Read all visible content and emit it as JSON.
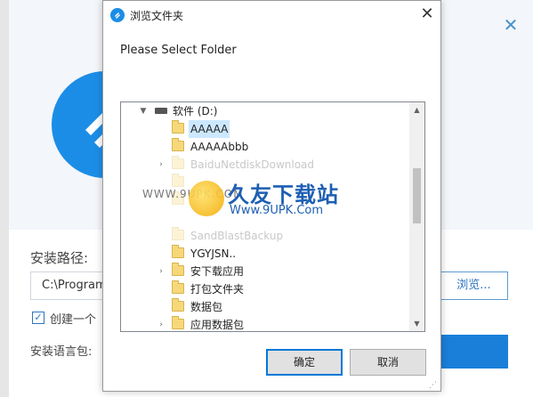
{
  "installer": {
    "path_label": "安装路径:",
    "path_value": "C:\\Program",
    "browse_label": "浏览...",
    "create_shortcut_label": "创建一个",
    "lang_label": "安装语言包:",
    "close_glyph": "✕"
  },
  "dialog": {
    "title": "浏览文件夹",
    "prompt": "Please Select Folder",
    "close_glyph": "✕",
    "ok_label": "确定",
    "cancel_label": "取消",
    "tree": [
      {
        "label": "软件 (D:)",
        "type": "drive",
        "expanded": true
      },
      {
        "label": "AAAAA",
        "type": "folder",
        "selected": true
      },
      {
        "label": "AAAAAbbb",
        "type": "folder"
      },
      {
        "label": "BaiduNetdiskDownload",
        "type": "folder",
        "expandable": true
      },
      {
        "label": "",
        "type": "folder"
      },
      {
        "label": "",
        "type": "folder"
      },
      {
        "label": "SandBlastBackup",
        "type": "folder"
      },
      {
        "label": "YGYJSN..",
        "type": "folder"
      },
      {
        "label": "安下载应用",
        "type": "folder",
        "expandable": true
      },
      {
        "label": "打包文件夹",
        "type": "folder"
      },
      {
        "label": "数据包",
        "type": "folder"
      },
      {
        "label": "应用数据包",
        "type": "folder",
        "expandable": true
      }
    ]
  },
  "watermark": {
    "title": "久友下载站",
    "url": "Www.9UPK.Com",
    "left_text": "WWW.9UPK.COM"
  },
  "colors": {
    "accent": "#1c8de6",
    "selection": "#cce8ff",
    "ok_border": "#0078d7"
  }
}
